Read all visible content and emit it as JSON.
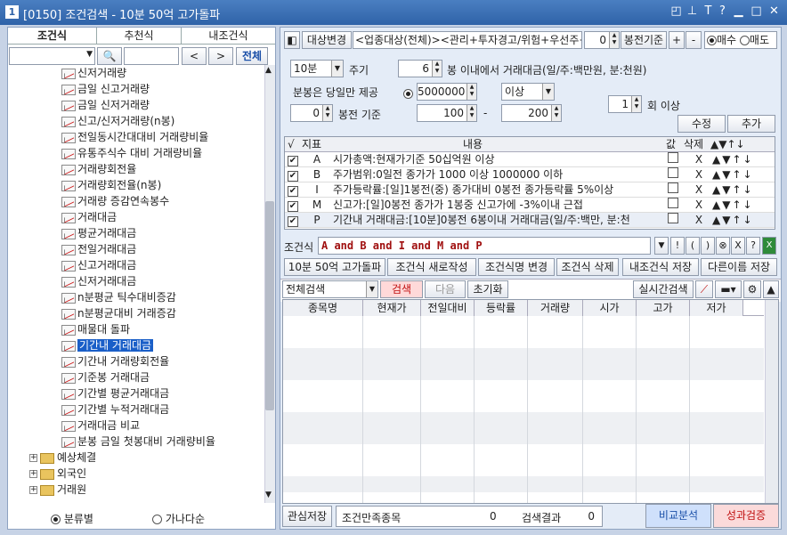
{
  "window": {
    "number": "1",
    "title": "[0150] 조건검색 - 10분 50억 고가돌파"
  },
  "left": {
    "tabs": [
      "조건식",
      "추천식",
      "내조건식"
    ],
    "all_button": "전체",
    "tree_items": [
      "신저거래량",
      "금일 신고거래량",
      "금일 신저거래량",
      "신고/신저거래량(n봉)",
      "전일동시간대대비 거래량비율",
      "유통주식수 대비 거래량비율",
      "거래량회전율",
      "거래량회전율(n봉)",
      "거래량 증감연속봉수",
      "거래대금",
      "평균거래대금",
      "전일거래대금",
      "신고거래대금",
      "신저거래대금",
      "n분평균 틱수대비증감",
      "n분평균대비 거래증감",
      "매물대 돌파",
      "기간내 거래대금",
      "기간내 거래량회전율",
      "기준봉 거래대금",
      "기간별 평균거래대금",
      "기간별 누적거래대금",
      "거래대금 비교",
      "분봉 금일 첫봉대비 거래량비율"
    ],
    "selected_item": "기간내 거래대금",
    "folders": [
      "예상체결",
      "외국인",
      "거래원"
    ],
    "radio_category": "분류별",
    "radio_alpha": "가나다순"
  },
  "right": {
    "target_change": "대상변경",
    "target_value": "<업종대상(전체)><관리+투자경고/위험+우선주+",
    "bong_count": "0",
    "bong_label": "봉전기준",
    "plus": "+",
    "minus": "-",
    "buy": "매수",
    "sell": "매도",
    "period_value": "10분",
    "period_label": "주기",
    "bong_note": "분봉은 당일만 제공",
    "bong_base_value": "0",
    "bong_base_label": "봉전 기준",
    "within_value": "6",
    "within_label": "봉 이내에서 거래대금(일/주:백만원, 분:천원)",
    "amount_value": "5000000",
    "amount_cond": "이상",
    "range_from": "100",
    "range_sep": "-",
    "range_to": "200",
    "times_value": "1",
    "times_label": "회 이상",
    "modify": "수정",
    "add": "추가",
    "table_headers": [
      "√",
      "지표",
      "내용",
      "값",
      "삭제",
      "▲▼↑↓"
    ],
    "conditions": [
      {
        "id": "A",
        "text": "시가총액:현재가기준 50십억원 이상"
      },
      {
        "id": "B",
        "text": "주가범위:0일전 종가가 1000 이상 1000000 이하"
      },
      {
        "id": "I",
        "text": "주가등락률:[일]1봉전(중) 종가대비 0봉전 종가등락률 5%이상"
      },
      {
        "id": "M",
        "text": "신고가:[일]0봉전 종가가 1봉중 신고가에 -3%이내 근접"
      },
      {
        "id": "P",
        "text": "기간내 거래대금:[10분]0봉전 6봉이내 거래대금(일/주:백만, 분:천"
      }
    ],
    "delete_mark": "X",
    "move_marks": "▲▼↑↓",
    "formula_label": "조건식",
    "formula": "A and B and I and M and P",
    "formula_tools": [
      "!",
      "(",
      ")",
      "⊗",
      "X",
      "?"
    ],
    "bottom_buttons": [
      "10분 50억 고가돌파",
      "조건식 새로작성",
      "조건식명 변경",
      "조건식 삭제",
      "내조건식 저장",
      "다른이름 저장"
    ],
    "search_scope": "전체검색",
    "search": "검색",
    "next": "다음",
    "reset": "초기화",
    "realtime": "실시간검색",
    "grid_headers": [
      "종목명",
      "현재가",
      "전일대비",
      "등락률",
      "거래량",
      "시가",
      "고가",
      "저가"
    ],
    "fav_save": "관심저장",
    "satisfied_label": "조건만족종목",
    "satisfied_value": "0",
    "result_label": "검색결과",
    "result_value": "0",
    "compare": "비교분석",
    "verify": "성과검증"
  },
  "colors": {
    "title_bar": "#2f63a8",
    "selected": "#1a5fc8",
    "search_btn": "#ffd9d9",
    "compare_btn": "#cfe0fb",
    "verify_btn": "#fbdada"
  }
}
